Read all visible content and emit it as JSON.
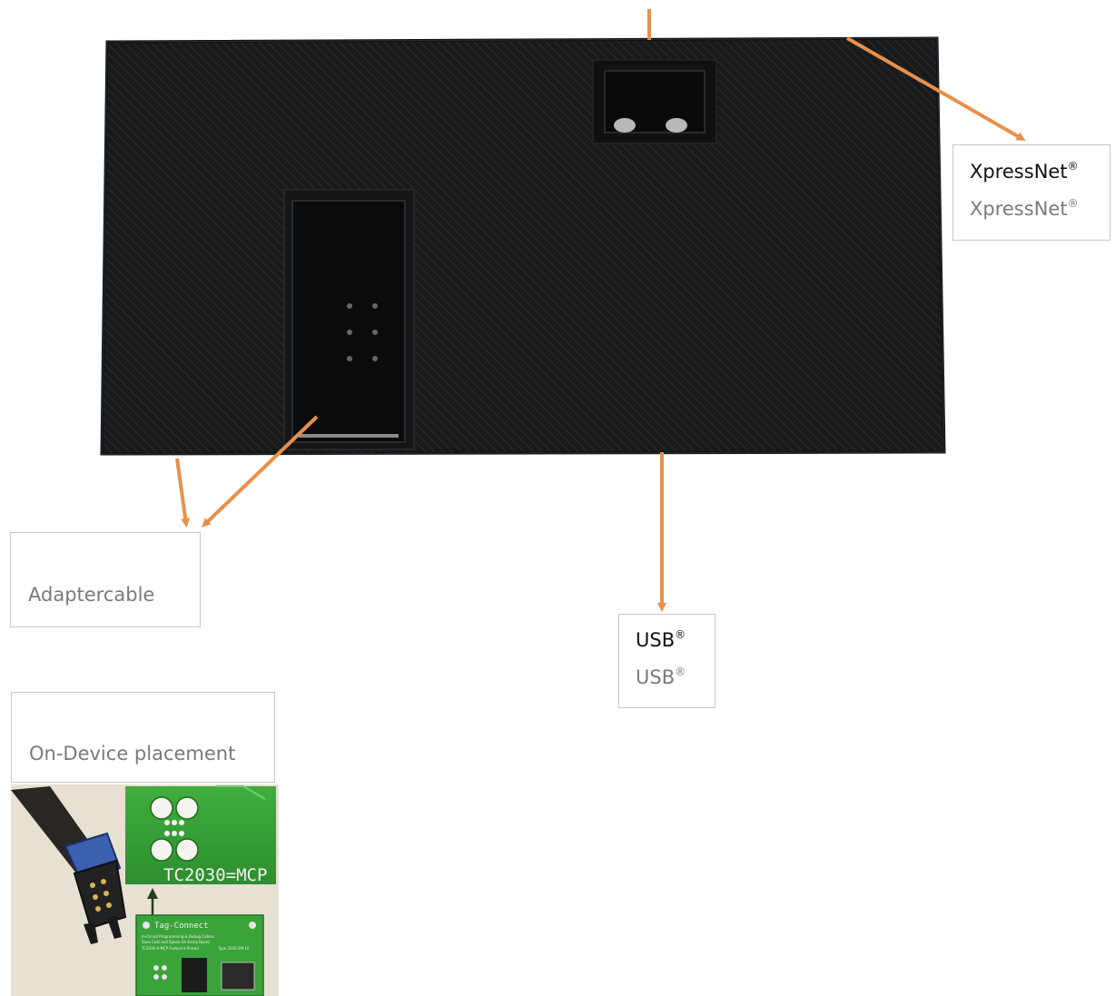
{
  "labels": {
    "xpressnet": {
      "name": "XpressNet",
      "name_alt": "XpressNet",
      "mark": "®"
    },
    "adapter": {
      "name": "Adaptercable"
    },
    "usb": {
      "name": "USB",
      "name_alt": "USB",
      "mark": "®"
    },
    "placement": {
      "name": "On-Device placement"
    }
  },
  "pcb": {
    "footprint_text": "TC2030=MCP",
    "board_title": "Tag-Connect",
    "board_text_1": "In-Circuit Programming & Debug Cables",
    "board_text_2": "Save Cost and Space On Every Board",
    "board_text_3": "TC2030 6-MCP Footprint Shown",
    "board_text_4": "Type 2030 SM-10"
  },
  "colors": {
    "enclosure": "#151618",
    "arrow": "#e8904a",
    "pcb": "#3aa33a",
    "box_border": "#c9c9c9"
  }
}
